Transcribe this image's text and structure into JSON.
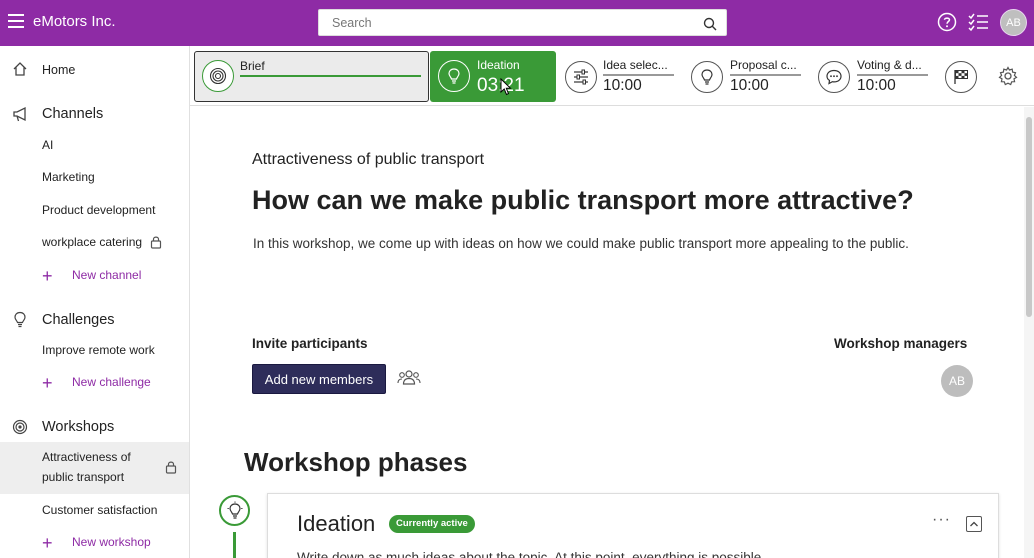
{
  "header": {
    "app_title": "eMotors Inc.",
    "search_placeholder": "Search",
    "user_initials": "AB"
  },
  "sidebar": {
    "home": "Home",
    "channels": {
      "title": "Channels",
      "items": [
        "AI",
        "Marketing",
        "Product development",
        "workplace catering"
      ],
      "add_label": "New channel"
    },
    "challenges": {
      "title": "Challenges",
      "items": [
        "Improve remote work"
      ],
      "add_label": "New challenge"
    },
    "workshops": {
      "title": "Workshops",
      "items": [
        "Attractiveness of",
        "public transport",
        "Customer satisfaction"
      ],
      "add_label": "New workshop"
    }
  },
  "phases": [
    {
      "label": "Brief",
      "time": "",
      "state": "visited"
    },
    {
      "label": "Ideation",
      "time": "03:21",
      "state": "active"
    },
    {
      "label": "Idea selec...",
      "time": "10:00",
      "state": "upcoming"
    },
    {
      "label": "Proposal c...",
      "time": "10:00",
      "state": "upcoming"
    },
    {
      "label": "Voting & d...",
      "time": "10:00",
      "state": "upcoming"
    },
    {
      "label": "",
      "time": "",
      "state": "finish"
    }
  ],
  "main": {
    "subtitle": "Attractiveness of public transport",
    "headline": "How can we make public transport more attractive?",
    "description": "In this workshop, we come up with ideas on how we could make public transport more appealing to the public.",
    "invite_title": "Invite participants",
    "add_members_label": "Add new members",
    "managers_title": "Workshop managers",
    "manager_initials": "AB",
    "phases_title": "Workshop phases",
    "card": {
      "title": "Ideation",
      "badge": "Currently active",
      "dots": "···",
      "text": "Write down as much ideas about the topic. At this point, everything is possible."
    }
  },
  "colors": {
    "brand": "#8e2ba5",
    "active_green": "#3a9a37",
    "button_navy": "#2e2d5a"
  }
}
